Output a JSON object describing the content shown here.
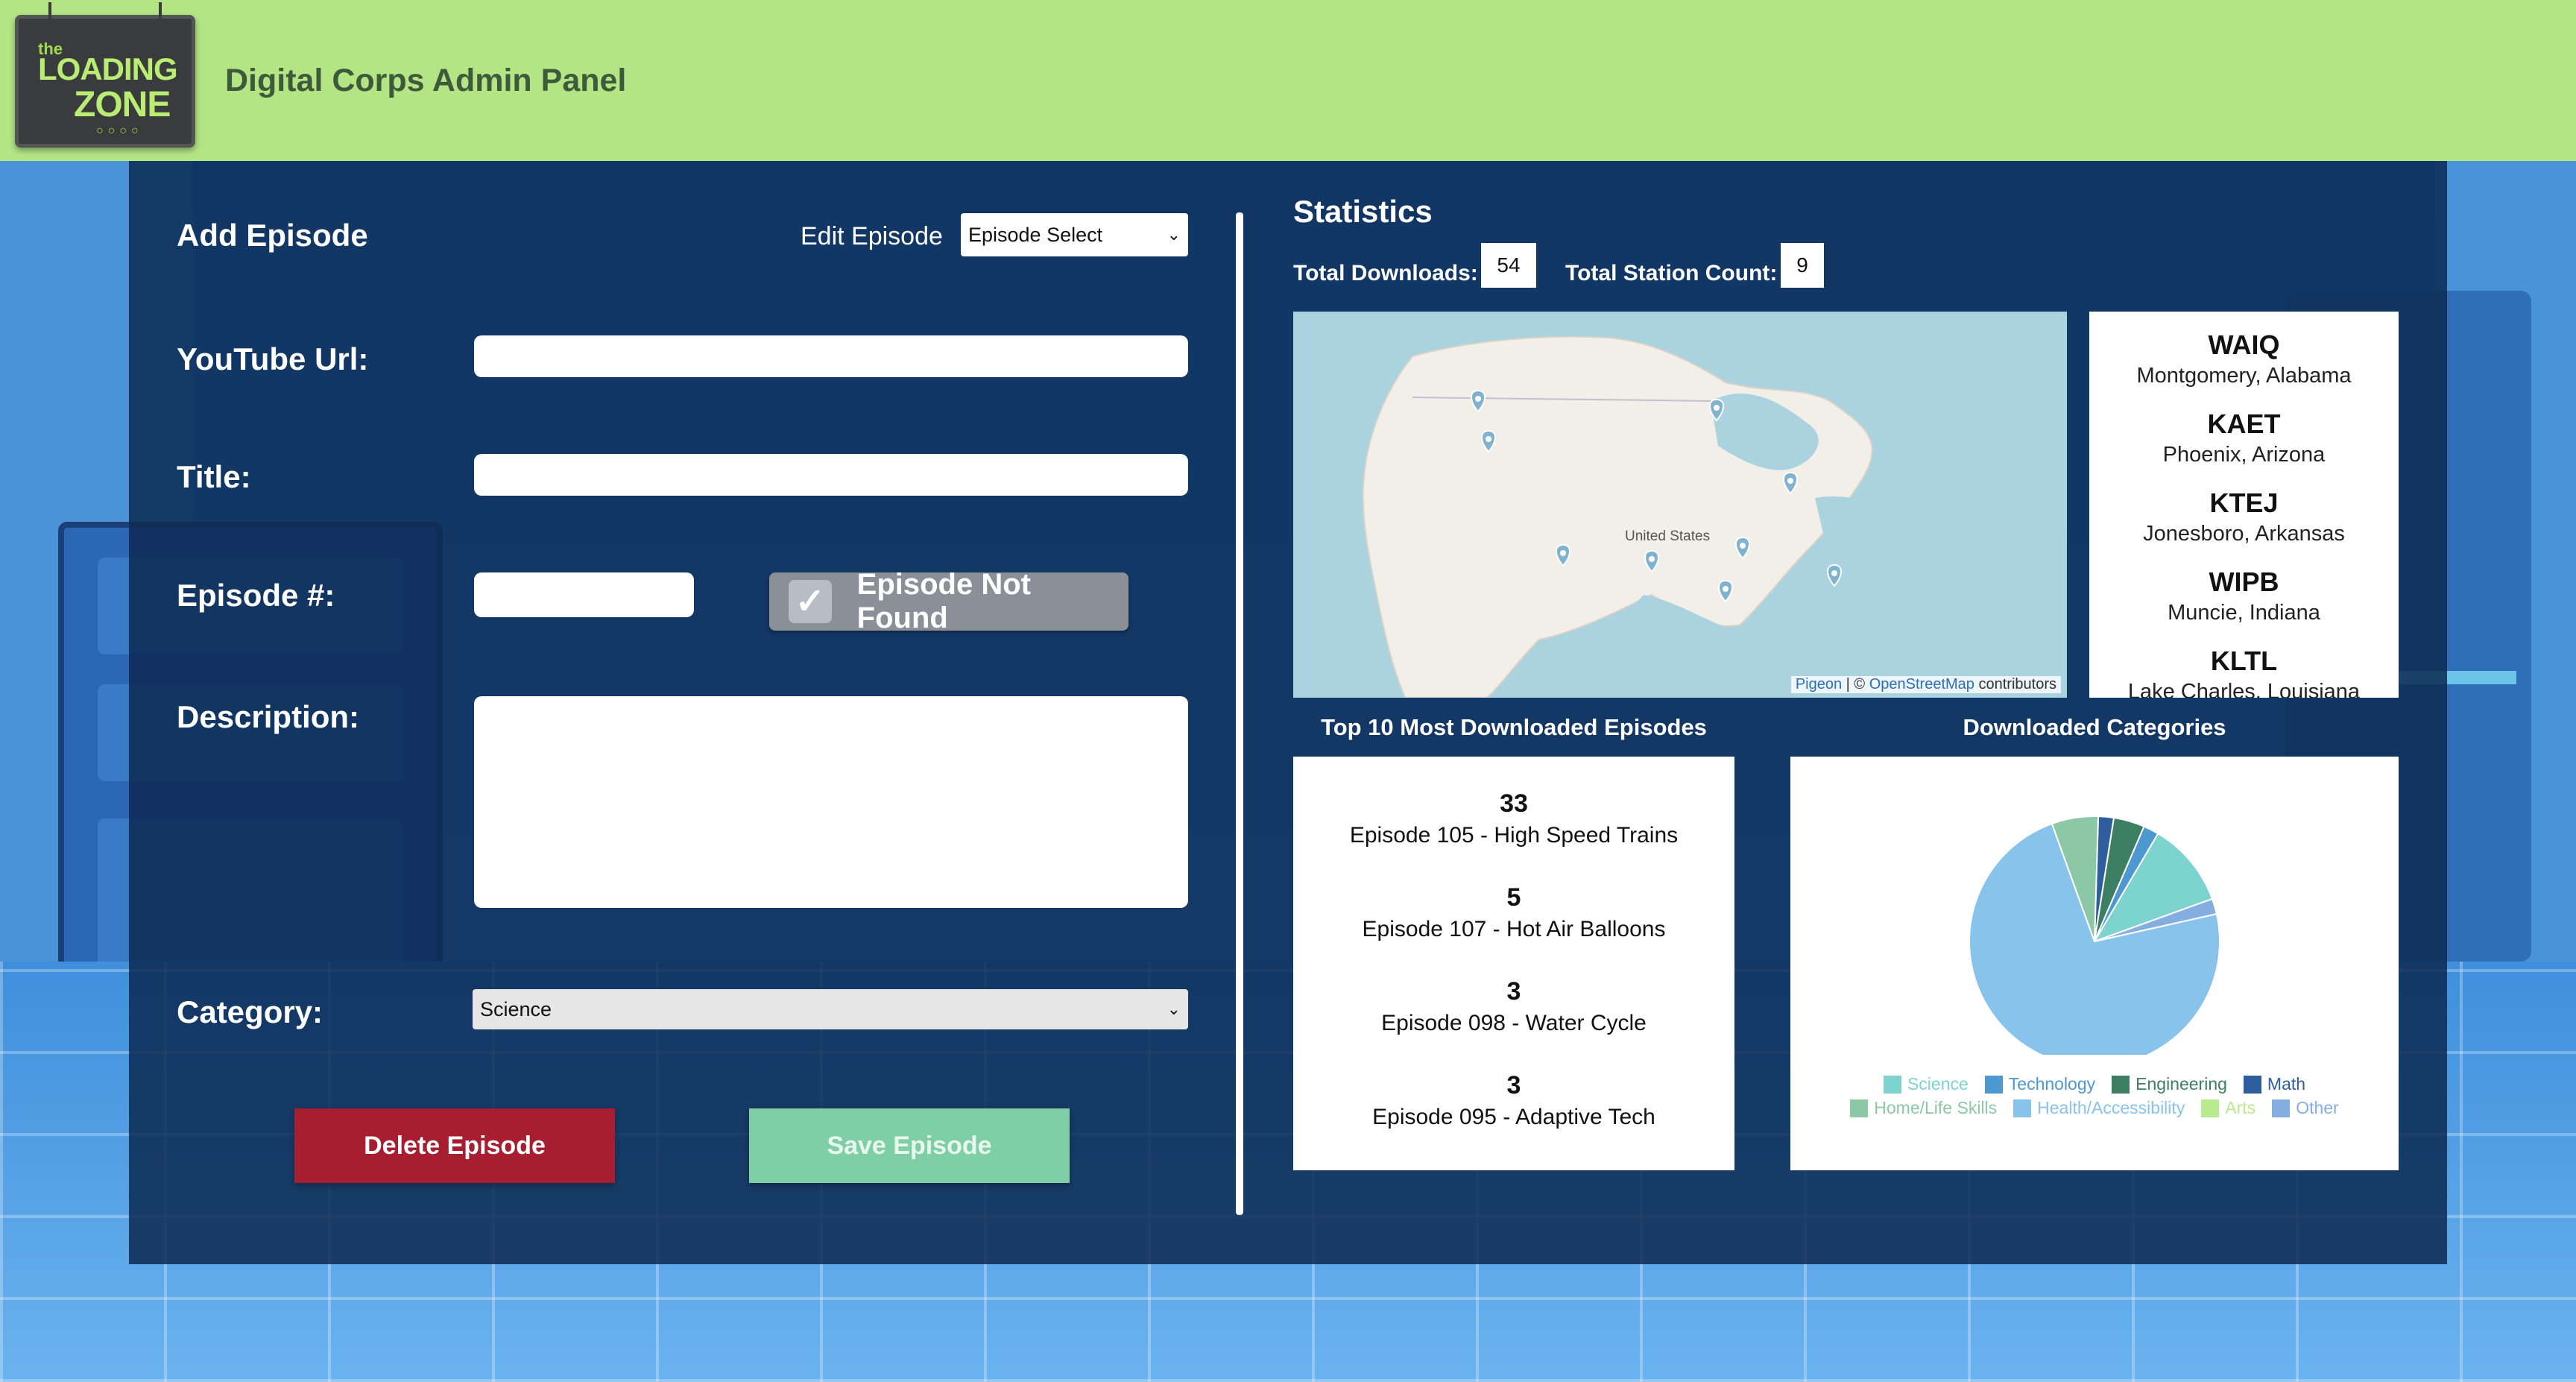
{
  "header": {
    "logo": {
      "top": "the",
      "line1": "LOADING",
      "line2": "ZONE",
      "dots": "○○○○"
    },
    "title": "Digital Corps Admin Panel"
  },
  "add_episode": {
    "heading": "Add Episode",
    "edit_label": "Edit Episode",
    "episode_select": "Episode Select",
    "youtube_label": "YouTube Url:",
    "youtube_value": "",
    "title_label": "Title:",
    "title_value": "",
    "episode_num_label": "Episode #:",
    "episode_num_value": "",
    "not_found_label": "Episode Not Found",
    "description_label": "Description:",
    "description_value": "",
    "category_label": "Category:",
    "category_value": "Science",
    "delete_label": "Delete Episode",
    "save_label": "Save Episode"
  },
  "statistics": {
    "heading": "Statistics",
    "total_downloads_label": "Total Downloads:",
    "total_downloads": "54",
    "station_count_label": "Total Station Count:",
    "station_count": "9",
    "map": {
      "country_label": "United States",
      "attribution_link1": "Pigeon",
      "attribution_sep": " | © ",
      "attribution_link2": "OpenStreetMap",
      "attribution_tail": " contributors"
    },
    "stations": [
      {
        "call": "WAIQ",
        "location": "Montgomery, Alabama"
      },
      {
        "call": "KAET",
        "location": "Phoenix, Arizona"
      },
      {
        "call": "KTEJ",
        "location": "Jonesboro, Arkansas"
      },
      {
        "call": "WIPB",
        "location": "Muncie, Indiana"
      },
      {
        "call": "KLTL",
        "location": "Lake Charles, Louisiana"
      }
    ],
    "top_episodes_title": "Top 10 Most Downloaded Episodes",
    "top_episodes": [
      {
        "count": "33",
        "name": "Episode 105 - High Speed Trains"
      },
      {
        "count": "5",
        "name": "Episode 107 - Hot Air Balloons"
      },
      {
        "count": "3",
        "name": "Episode 098 - Water Cycle"
      },
      {
        "count": "3",
        "name": "Episode 095 - Adaptive Tech"
      }
    ],
    "categories_title": "Downloaded Categories"
  },
  "chart_data": {
    "type": "pie",
    "title": "Downloaded Categories",
    "categories": [
      "Science",
      "Technology",
      "Engineering",
      "Math",
      "Home/Life Skills",
      "Health/Accessibility",
      "Arts",
      "Other"
    ],
    "values": [
      11,
      2,
      4,
      2,
      6,
      73,
      0,
      2
    ],
    "colors": [
      "#7dd3cd",
      "#4e98d2",
      "#3c7f63",
      "#2e5e9e",
      "#8cc8a6",
      "#88c3ec",
      "#b9ea8e",
      "#85aee0"
    ],
    "legend_position": "bottom"
  }
}
